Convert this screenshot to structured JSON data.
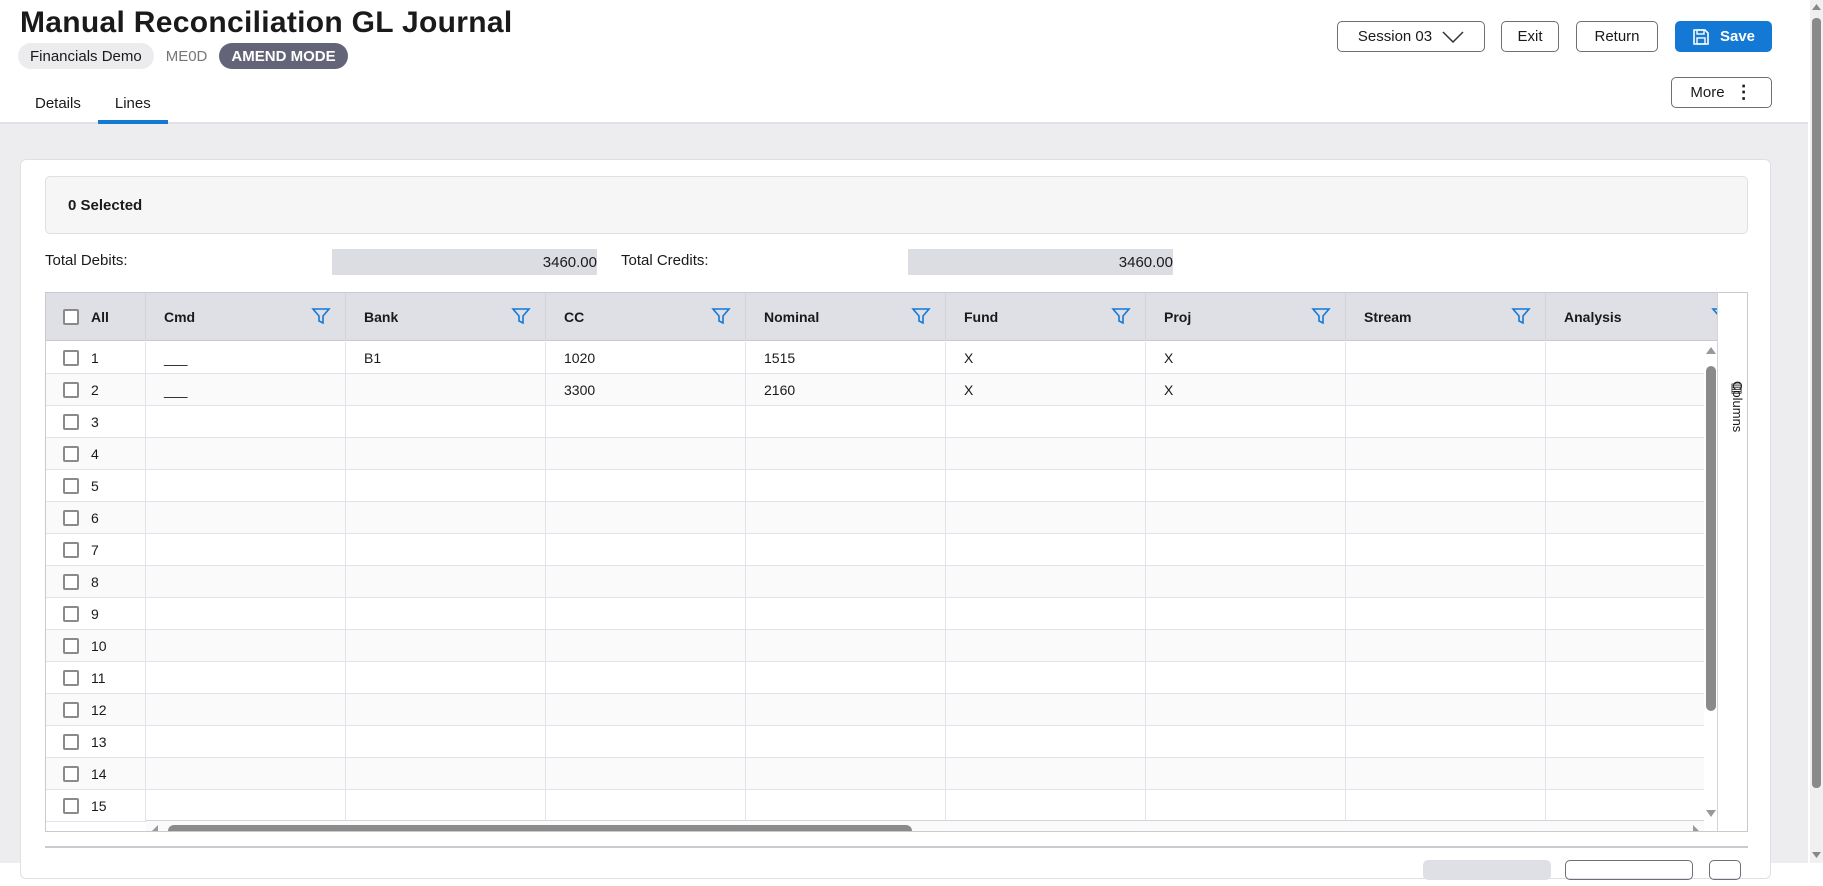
{
  "header": {
    "title": "Manual Reconciliation GL Journal",
    "org": "Financials Demo",
    "code": "ME0D",
    "mode": "AMEND MODE"
  },
  "tabs": [
    {
      "label": "Details"
    },
    {
      "label": "Lines",
      "active": true
    }
  ],
  "actions": {
    "session": "Session 03",
    "exit": "Exit",
    "return": "Return",
    "save": "Save",
    "more": "More"
  },
  "selection": {
    "text": "0 Selected"
  },
  "totals": {
    "debits_label": "Total Debits:",
    "debits": "3460.00",
    "credits_label": "Total Credits:",
    "credits": "3460.00"
  },
  "grid": {
    "all_label": "All",
    "columns": [
      "Cmd",
      "Bank",
      "CC",
      "Nominal",
      "Fund",
      "Proj",
      "Stream",
      "Analysis"
    ],
    "rows": [
      {
        "n": "1",
        "cells": [
          "___",
          "B1",
          "1020",
          "1515",
          "X",
          "X",
          "",
          ""
        ]
      },
      {
        "n": "2",
        "cells": [
          "___",
          "",
          "3300",
          "2160",
          "X",
          "X",
          "",
          ""
        ]
      },
      {
        "n": "3",
        "cells": [
          "",
          "",
          "",
          "",
          "",
          "",
          "",
          ""
        ]
      },
      {
        "n": "4",
        "cells": [
          "",
          "",
          "",
          "",
          "",
          "",
          "",
          ""
        ]
      },
      {
        "n": "5",
        "cells": [
          "",
          "",
          "",
          "",
          "",
          "",
          "",
          ""
        ]
      },
      {
        "n": "6",
        "cells": [
          "",
          "",
          "",
          "",
          "",
          "",
          "",
          ""
        ]
      },
      {
        "n": "7",
        "cells": [
          "",
          "",
          "",
          "",
          "",
          "",
          "",
          ""
        ]
      },
      {
        "n": "8",
        "cells": [
          "",
          "",
          "",
          "",
          "",
          "",
          "",
          ""
        ]
      },
      {
        "n": "9",
        "cells": [
          "",
          "",
          "",
          "",
          "",
          "",
          "",
          ""
        ]
      },
      {
        "n": "10",
        "cells": [
          "",
          "",
          "",
          "",
          "",
          "",
          "",
          ""
        ]
      },
      {
        "n": "11",
        "cells": [
          "",
          "",
          "",
          "",
          "",
          "",
          "",
          ""
        ]
      },
      {
        "n": "12",
        "cells": [
          "",
          "",
          "",
          "",
          "",
          "",
          "",
          ""
        ]
      },
      {
        "n": "13",
        "cells": [
          "",
          "",
          "",
          "",
          "",
          "",
          "",
          ""
        ]
      },
      {
        "n": "14",
        "cells": [
          "",
          "",
          "",
          "",
          "",
          "",
          "",
          ""
        ]
      },
      {
        "n": "15",
        "cells": [
          "",
          "",
          "",
          "",
          "",
          "",
          "",
          ""
        ]
      }
    ],
    "columns_panel": "Columns"
  },
  "colors": {
    "accent": "#1479d4",
    "mode_chip": "#646478"
  }
}
